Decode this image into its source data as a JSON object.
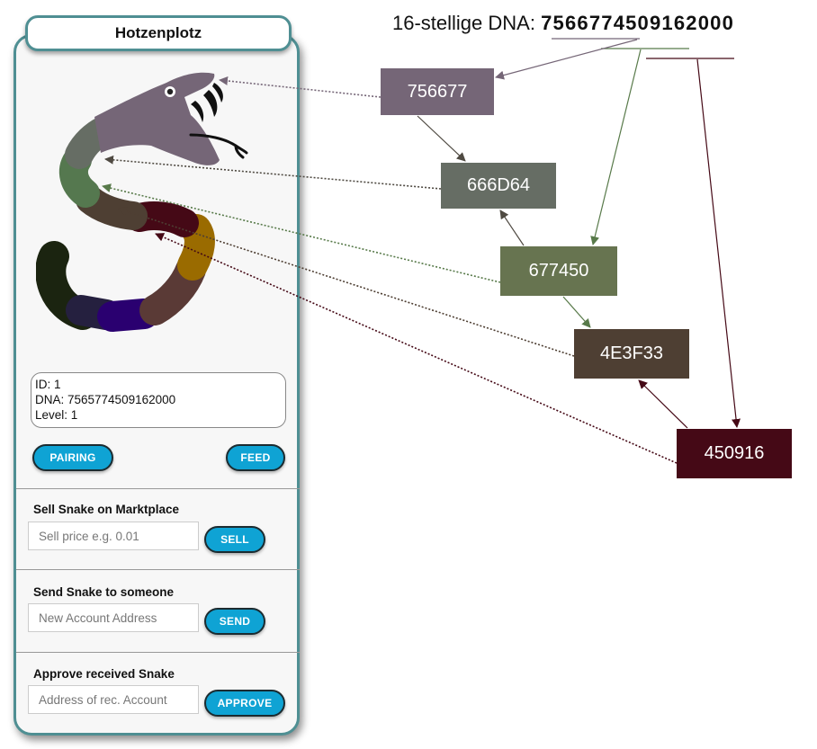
{
  "snake_name": "Hotzenplotz",
  "info": {
    "id_line": "ID: 1",
    "dna_line": "DNA: 7565774509162000",
    "level_line": "Level: 1"
  },
  "buttons": {
    "pairing": "PAIRING",
    "feed": "FEED",
    "sell": "SELL",
    "send": "SEND",
    "approve": "APPROVE"
  },
  "sell_section": {
    "label": "Sell Snake on Marktplace",
    "placeholder": "Sell price e.g. 0.01"
  },
  "send_section": {
    "label": "Send Snake to someone",
    "placeholder": "New Account Address"
  },
  "approve_section": {
    "label": "Approve received Snake",
    "placeholder": "Address of rec. Account"
  },
  "dna_title": {
    "prefix": "16-stellige DNA: ",
    "value": "7566774509162000"
  },
  "color_codes": [
    {
      "code": "756677",
      "color": "#756677"
    },
    {
      "code": "666D64",
      "color": "#666D64"
    },
    {
      "code": "677450",
      "color": "#677450"
    },
    {
      "code": "4E3F33",
      "color": "#4E3F33"
    },
    {
      "code": "450916",
      "color": "#450916"
    }
  ],
  "snake_colors": {
    "head": "#756677",
    "neck": "#666D64",
    "upper_body": "#55784f",
    "mid_body": "#4E3F33",
    "dark_red": "#450916",
    "gold": "#9a6b00",
    "brown": "#5a3a36",
    "indigo": "#2a0070",
    "navy": "#25203f",
    "tail": "#1b2410"
  },
  "accent": "#0fa3d4",
  "card_border": "#4f8f93"
}
